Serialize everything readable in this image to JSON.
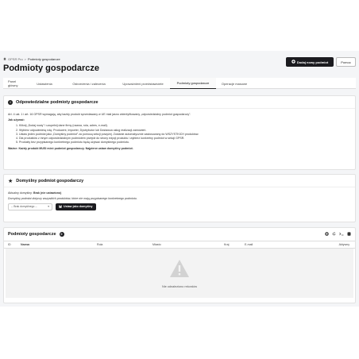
{
  "breadcrumb": {
    "home": "GPSR Pro",
    "separator": ">",
    "current": "Podmioty gospodarcze"
  },
  "page_title": "Podmioty gospodarcze",
  "header_buttons": {
    "add_label": "Dodaj nowy podmiot",
    "help_label": "Pomoc"
  },
  "tabs": [
    {
      "label": "Panel główny",
      "active": false
    },
    {
      "label": "Ustawienia",
      "active": false
    },
    {
      "label": "Ostrzeżenia i zalecenia",
      "active": false
    },
    {
      "label": "Upoważnieni przedstawiciele",
      "active": false
    },
    {
      "label": "Podmioty gospodarcze",
      "active": true
    },
    {
      "label": "Operacje masowe",
      "active": false
    }
  ],
  "responsible": {
    "title": "Odpowiedzialne podmioty gospodarcze",
    "intro": "Art. 4 ust. 1 i art. 16 GPSR wymagają, aby każdy produkt sprzedawany w UE miał jasno zidentyfikowany „odpowiedzialny podmiot gospodarczy”.",
    "how_to": "Jak używać:",
    "steps": [
      "Kliknij „Dodaj nowy” i uzupełnij dane firmy (nazwa, rola, adres, e-mail).",
      "Wybierz odpowiednią rolę: Producent, Importer, Dystrybutor lub Dostawca usług realizacji zamówień.",
      "Ustaw jeden podmiot jako „Domyślny podmiot” za pomocą sekcji powyżej. Zostanie automatycznie zastosowany do WSZYSTKICH produktów.",
      "Dla produktów z innym odpowiedzialnym podmiotem przejdź do strony edycji produktu i wybierz konkretny podmiot w sekcji GPSR.",
      "Produkty bez przypisanego konkretnego podmiotu będą używać domyślnego podmiotu."
    ],
    "important": "Ważne: Każdy produkt MUSI mieć podmiot gospodarczy. Najpierw ustaw domyślny podmiot."
  },
  "default_entity": {
    "title": "Domyślny podmiot gospodarczy",
    "current_label": "Aktualny domyślny:",
    "current_value": "Brak (nie ustawiono)",
    "hint": "Domyślny podmiot dotyczy wszystkich produktów, które nie mają przypisanego konkretnego podmiotu.",
    "select_value": "-- Brak domyślnego --",
    "set_button": "Ustaw jako domyślny"
  },
  "list": {
    "title": "Podmioty gospodarcze",
    "count": "0",
    "columns": [
      "ID",
      "Nazwa",
      "Rola",
      "Miasto",
      "Kraj",
      "E-mail",
      "Aktywny"
    ],
    "empty_text": "Nie odnaleziono rekordów"
  },
  "colors": {
    "primary_button": "#1b1b1f",
    "page_bg": "#f4f5f7",
    "card_bg": "#ffffff"
  },
  "icons": {
    "info": "info-circle-icon",
    "star": "star-icon",
    "add": "plus-circle-icon",
    "empty": "warning-triangle-icon"
  }
}
